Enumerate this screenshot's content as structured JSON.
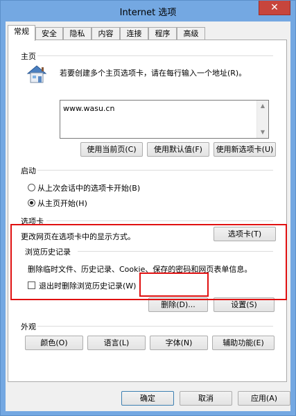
{
  "window": {
    "title": "Internet 选项",
    "close_glyph": "✕"
  },
  "tabs": [
    "常规",
    "安全",
    "隐私",
    "内容",
    "连接",
    "程序",
    "高级"
  ],
  "home": {
    "title": "主页",
    "description": "若要创建多个主页选项卡，请在每行输入一个地址(R)。",
    "url": "www.wasu.cn",
    "buttons": [
      "使用当前页(C)",
      "使用默认值(F)",
      "使用新选项卡(U)"
    ]
  },
  "startup": {
    "title": "启动",
    "option_last": "从上次会话中的选项卡开始(B)",
    "option_home": "从主页开始(H)",
    "selected": "option_home"
  },
  "tabs_group": {
    "title": "选项卡",
    "description": "更改网页在选项卡中的显示方式。",
    "button": "选项卡(T)"
  },
  "history": {
    "title": "浏览历史记录",
    "description": "删除临时文件、历史记录、Cookie、保存的密码和网页表单信息。",
    "checkbox_label": "退出时删除浏览历史记录(W)",
    "checked": false,
    "delete_button": "删除(D)...",
    "settings_button": "设置(S)"
  },
  "appearance": {
    "title": "外观",
    "buttons": [
      "颜色(O)",
      "语言(L)",
      "字体(N)",
      "辅助功能(E)"
    ]
  },
  "footer": {
    "ok": "确定",
    "cancel": "取消",
    "apply": "应用(A)"
  },
  "colors": {
    "highlight": "#e01010",
    "window_frame": "#74a8e2",
    "close_button": "#c7453c"
  },
  "icons": {
    "home": "house-icon"
  }
}
